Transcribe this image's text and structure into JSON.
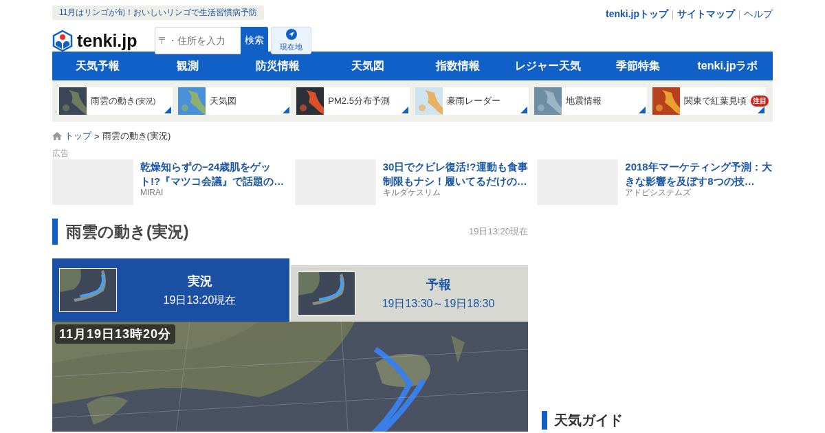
{
  "promo": {
    "text": "11月はリンゴが旬！おいしいリンゴで生活習慣病予防"
  },
  "logo": {
    "text": "tenki.jp"
  },
  "search": {
    "placeholder": "〒・住所を入力",
    "button": "検索"
  },
  "location_button": {
    "label": "現在地"
  },
  "top_links": [
    {
      "label": "tenki.jpトップ",
      "bold": true
    },
    {
      "label": "サイトマップ",
      "bold": true
    },
    {
      "label": "ヘルプ",
      "bold": false
    }
  ],
  "nav": [
    "天気予報",
    "観測",
    "防災情報",
    "天気図",
    "指数情報",
    "レジャー天気",
    "季節特集",
    "tenki.jpラボ"
  ],
  "quick_links": [
    {
      "label": "雨雲の動き",
      "sub": "(実況)",
      "kind": "radar"
    },
    {
      "label": "天気図",
      "kind": "chart"
    },
    {
      "label": "PM2.5分布予測",
      "kind": "pm"
    },
    {
      "label": "豪雨レーダー",
      "kind": "rain"
    },
    {
      "label": "地震情報",
      "kind": "quake"
    },
    {
      "label": "関東で紅葉見頃",
      "kind": "leaves",
      "badge": "注目"
    }
  ],
  "breadcrumb": {
    "home": "トップ",
    "separator": ">",
    "current": "雨雲の動き(実況)"
  },
  "ads": {
    "label": "広告",
    "items": [
      {
        "title": "乾燥知らずの−24歳肌をゲット!?『マツコ会議』で話題の…",
        "source": "MIRAI"
      },
      {
        "title": "30日でクビレ復活!?運動も食事制限もナシ！履いてるだけの…",
        "source": "キルダケスリム"
      },
      {
        "title": "2018年マーケティング予測：大きな影響を及ぼす8つの技…",
        "source": "アドビシステムズ"
      }
    ]
  },
  "section": {
    "title": "雨雲の動き(実況)",
    "time": "19日13:20現在"
  },
  "tabs": [
    {
      "title": "実況",
      "subtitle": "19日13:20現在",
      "selected": true
    },
    {
      "title": "予報",
      "subtitle": "19日13:30～19日18:30",
      "selected": false
    }
  ],
  "map": {
    "kind": "picture",
    "timestamp": "11月19日13時20分"
  },
  "sidebar": {
    "heading": "天気ガイド"
  }
}
